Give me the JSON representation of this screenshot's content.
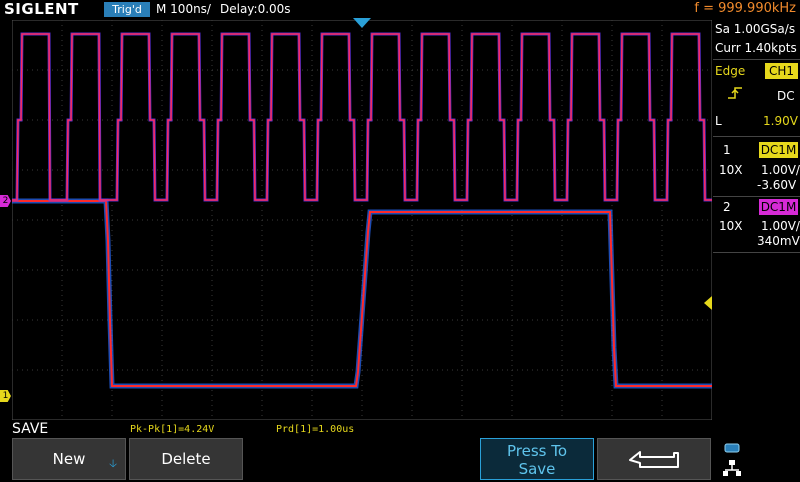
{
  "header": {
    "brand": "SIGLENT",
    "trigger_status": "Trig'd",
    "timebase": "M 100ns/",
    "delay": "Delay:0.00s",
    "frequency": "f = 999.990kHz"
  },
  "acquisition": {
    "sample_rate": "Sa 1.00GSa/s",
    "memory_depth": "Curr 1.40kpts"
  },
  "trigger": {
    "type_label": "Edge",
    "source": "CH1",
    "slope_icon": "rising-edge-icon",
    "coupling": "DC",
    "level_label": "L",
    "level": "1.90V"
  },
  "channels": [
    {
      "number": "1",
      "coupling": "DC1M",
      "probe": "10X",
      "scale": "1.00V/",
      "offset": "-3.60V",
      "color": "#e6d81c"
    },
    {
      "number": "2",
      "coupling": "DC1M",
      "probe": "10X",
      "scale": "1.00V/",
      "offset": "340mV",
      "color": "#d62ad6"
    }
  ],
  "markers": {
    "ch1": "1",
    "ch2": "2"
  },
  "measurements": {
    "pkpk": "Pk-Pk[1]=4.24V",
    "period": "Prd[1]=1.00us"
  },
  "menu": {
    "title": "SAVE",
    "new_label": "New",
    "delete_label": "Delete",
    "press_to_save_label": "Press To\nSave",
    "back_icon": "return-arrow-icon",
    "network_icon": "network-icon"
  },
  "colors": {
    "accent": "#2aa0d8",
    "ch1": "#e6d81c",
    "ch2": "#d62ad6",
    "frequency": "#f08a2c"
  }
}
